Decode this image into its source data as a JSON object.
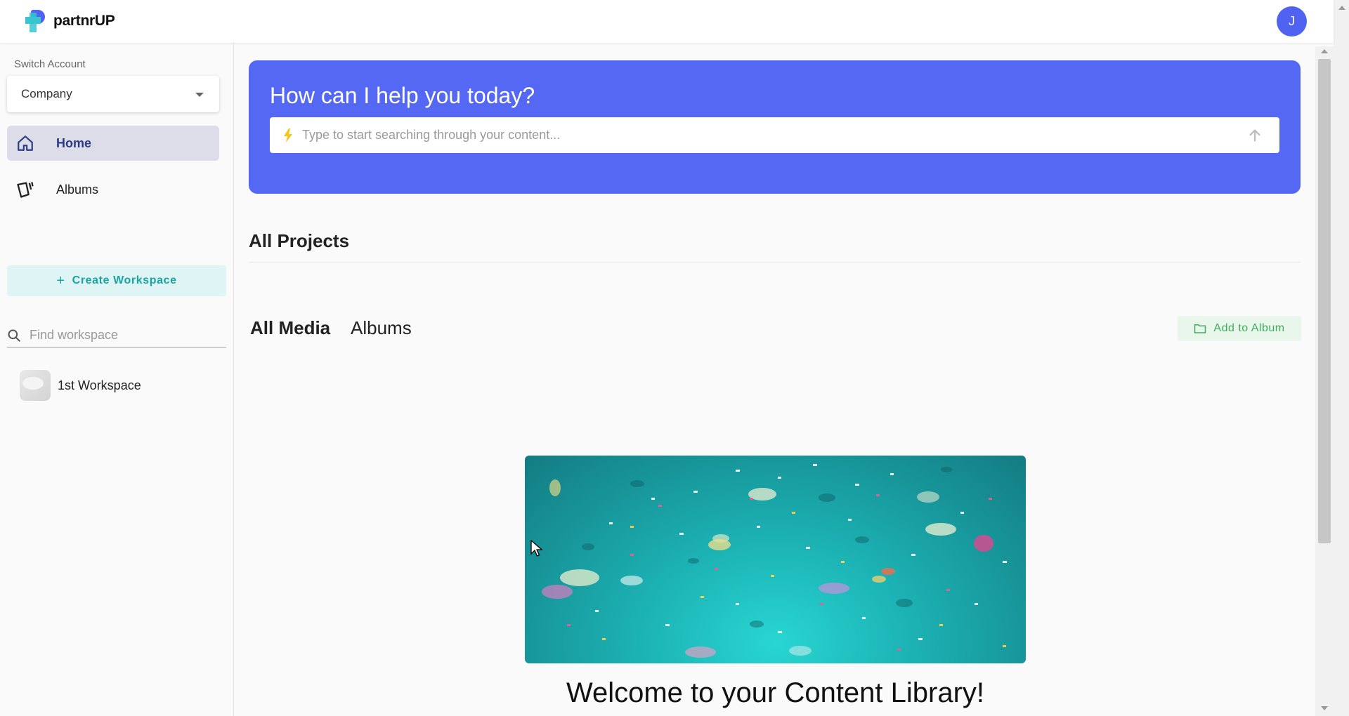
{
  "app": {
    "brand": "partnrUP",
    "avatar_initial": "J",
    "accent_color": "#5468f4"
  },
  "sidebar": {
    "switch_account_label": "Switch Account",
    "account_selected": "Company",
    "nav": [
      {
        "label": "Home",
        "icon": "home-icon",
        "active": true
      },
      {
        "label": "Albums",
        "icon": "albums-icon",
        "active": false
      }
    ],
    "create_workspace_label": "Create Workspace",
    "find_workspace_placeholder": "Find workspace",
    "workspaces": [
      {
        "label": "1st Workspace"
      }
    ]
  },
  "main": {
    "hero_title": "How can I help you today?",
    "search_placeholder": "Type to start searching through your content...",
    "projects_title": "All Projects",
    "tabs": [
      {
        "label": "All Media",
        "active": true
      },
      {
        "label": "Albums",
        "active": false
      }
    ],
    "add_to_album_label": "Add to Album",
    "welcome_text": "Welcome to your Content Library!"
  }
}
